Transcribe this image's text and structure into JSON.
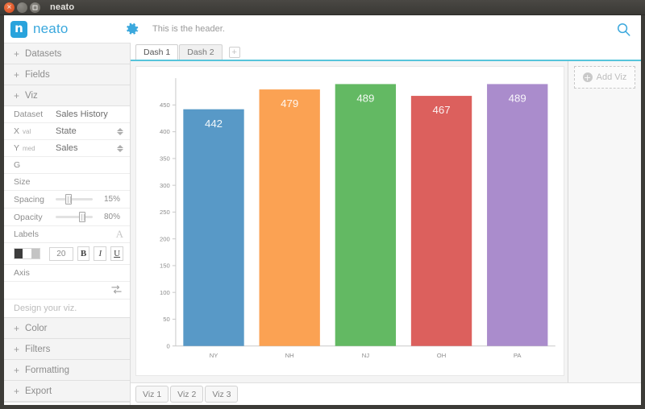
{
  "window": {
    "title": "neato",
    "buttons": {
      "close": "×",
      "minimize": "–",
      "maximize": "□"
    }
  },
  "app_header": {
    "logo_mark": "n",
    "logo_text": "neato",
    "gear_icon": "gear-icon",
    "header_text": "This is the header.",
    "search_icon": "search-icon"
  },
  "sidebar": {
    "accordions_top": [
      {
        "label": "Datasets",
        "plus": "+"
      },
      {
        "label": "Fields",
        "plus": "+"
      },
      {
        "label": "Viz",
        "plus": "+"
      }
    ],
    "viz_panel": {
      "dataset": {
        "label": "Dataset",
        "value": "Sales History"
      },
      "x": {
        "label": "X",
        "sub": "val",
        "value": "State"
      },
      "y": {
        "label": "Y",
        "sub": "med",
        "value": "Sales"
      },
      "g": {
        "label": "G",
        "value": ""
      },
      "size": {
        "label": "Size"
      },
      "spacing": {
        "label": "Spacing",
        "value": "15%",
        "percent": 15
      },
      "opacity": {
        "label": "Opacity",
        "value": "80%",
        "percent": 80
      },
      "labels": {
        "label": "Labels",
        "font_icon": "A"
      },
      "format": {
        "font_size": "20",
        "bold": "B",
        "italic": "I",
        "underline": "U",
        "swatch_colors": [
          "#3c3c3c",
          "#ffffff",
          "#c4c4c4"
        ]
      },
      "axis": {
        "label": "Axis"
      },
      "swap_icon": "swap-arrows-icon",
      "placeholder": "Design your viz."
    },
    "accordions_bottom": [
      {
        "label": "Color",
        "plus": "+"
      },
      {
        "label": "Filters",
        "plus": "+"
      },
      {
        "label": "Formatting",
        "plus": "+"
      },
      {
        "label": "Export",
        "plus": "+"
      }
    ]
  },
  "content": {
    "tabs": [
      {
        "label": "Dash 1",
        "active": true
      },
      {
        "label": "Dash 2",
        "active": false
      }
    ],
    "add_tab": "+",
    "viz_panel": {
      "add_viz_label": "Add Viz",
      "add_icon": "plus-circle-icon"
    },
    "bottom_tabs": [
      {
        "label": "Viz 1"
      },
      {
        "label": "Viz 2"
      },
      {
        "label": "Viz 3"
      }
    ]
  },
  "chart_data": {
    "type": "bar",
    "title": "",
    "xlabel": "",
    "ylabel": "",
    "categories": [
      "NY",
      "NH",
      "NJ",
      "OH",
      "PA"
    ],
    "values": [
      442,
      479,
      489,
      467,
      489
    ],
    "colors": [
      "#4a90c2",
      "#fb9a44",
      "#56b356",
      "#d9534f",
      "#a382c8"
    ],
    "ylim": [
      0,
      500
    ],
    "yticks": [
      0,
      50,
      100,
      150,
      200,
      250,
      300,
      350,
      400,
      450
    ],
    "grid": false,
    "legend": false,
    "data_labels": [
      "442",
      "479",
      "489",
      "467",
      "489"
    ]
  },
  "colors": {
    "accent": "#3ba8dd",
    "tab_underline": "#56c4db",
    "titlebar": "#3c3b37"
  }
}
